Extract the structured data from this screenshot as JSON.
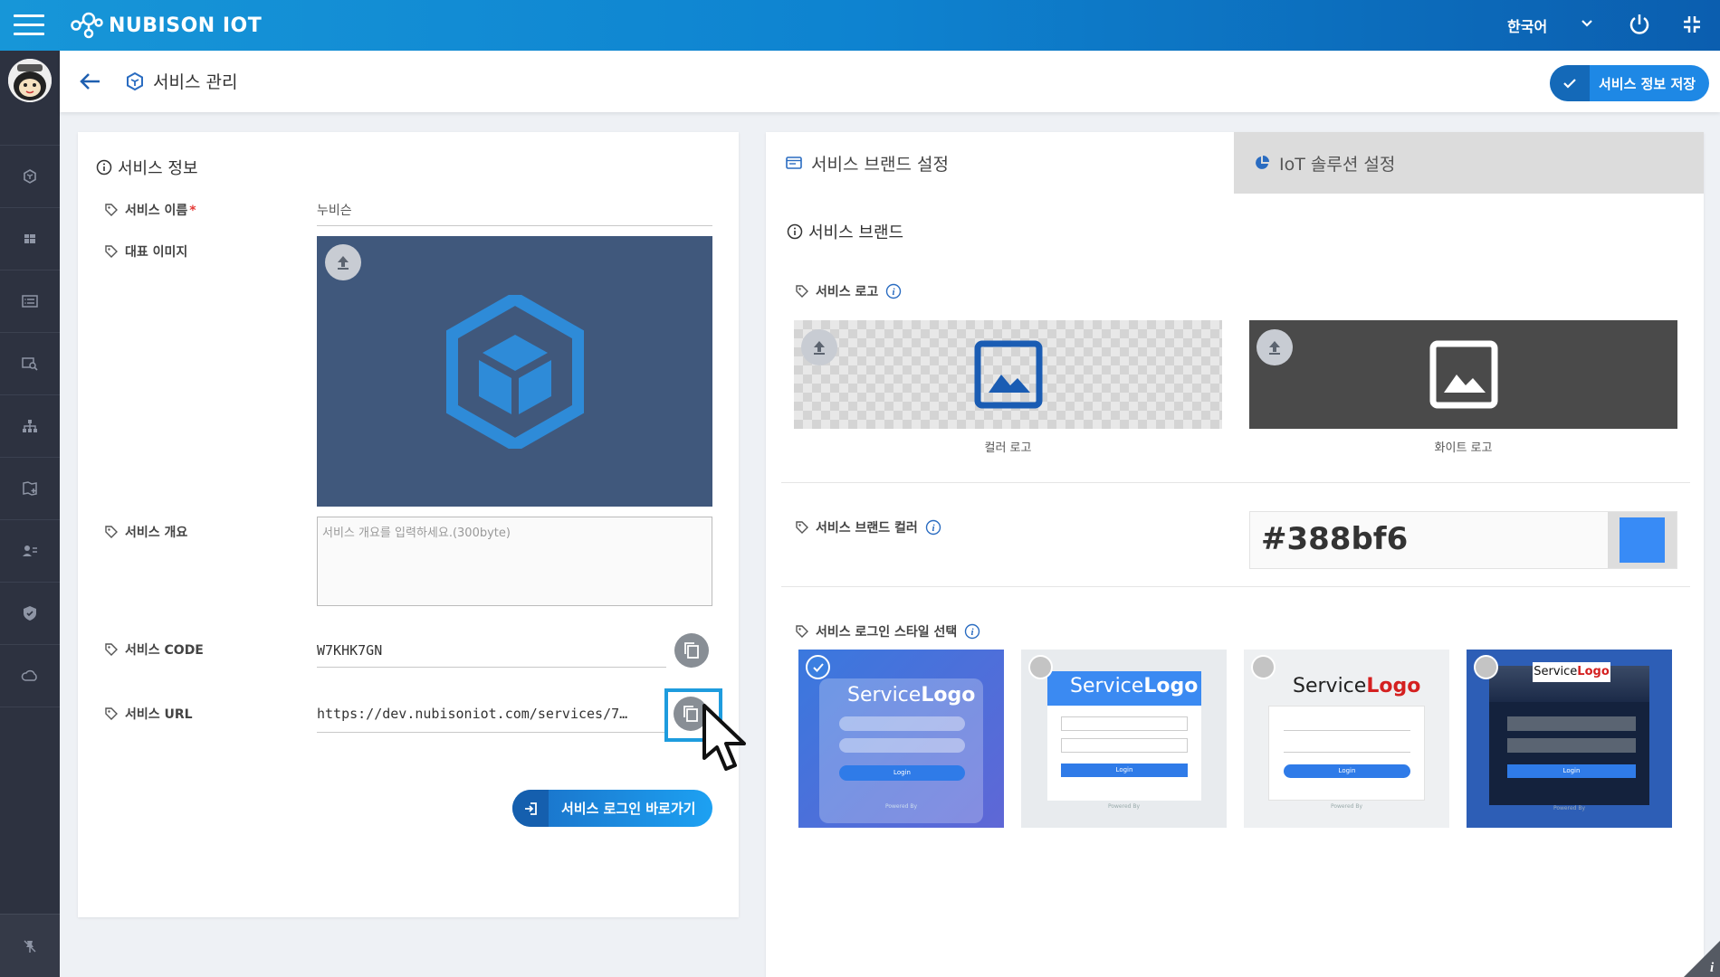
{
  "header": {
    "brand": "NUBISON IOT",
    "language": "한국어"
  },
  "subheader": {
    "title": "서비스 관리",
    "save_label": "서비스 정보 저장"
  },
  "service_info": {
    "title": "서비스 정보",
    "name_label": "서비스 이름",
    "name_required": "*",
    "name_value": "누비슨",
    "image_label": "대표 이미지",
    "summary_label": "서비스 개요",
    "summary_placeholder": "서비스 개요를 입력하세요.(300byte)",
    "code_label": "서비스 CODE",
    "code_value": "W7KHK7GN",
    "url_label": "서비스 URL",
    "url_value": "https://dev.nubisoniot.com/services/7…",
    "login_button": "서비스 로그인 바로가기"
  },
  "tabs": [
    {
      "label": "서비스 브랜드 설정",
      "active": true
    },
    {
      "label": "IoT 솔루션 설정",
      "active": false
    }
  ],
  "brand": {
    "title": "서비스 브랜드",
    "logo_label": "서비스 로고",
    "color_logo_caption": "컬러 로고",
    "white_logo_caption": "화이트 로고",
    "brand_color_label": "서비스 브랜드 컬러",
    "brand_color": "#388bf6",
    "login_style_label": "서비스 로그인 스타일 선택",
    "login_styles": [
      {
        "service": "Service",
        "logo": "Logo",
        "selected": true
      },
      {
        "service": "Service",
        "logo": "Logo",
        "selected": false
      },
      {
        "service": "Service",
        "logo": "Logo",
        "selected": false
      },
      {
        "service": "Service",
        "logo": "Logo",
        "selected": false
      }
    ],
    "login_text": "Login",
    "powered_by": "Powered By"
  },
  "colors": {
    "topbar": "#0e83d0",
    "sidebar": "#2d3240",
    "accent": "#1e88e5",
    "image_bg": "#40587c"
  }
}
